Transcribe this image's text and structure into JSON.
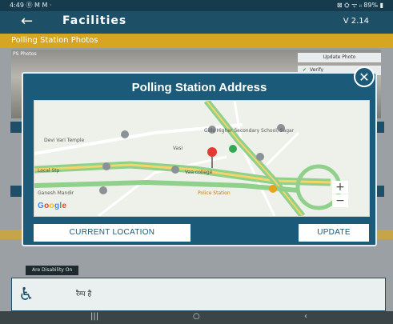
{
  "status_bar": {
    "left": "4:49 ⓪ M M ·",
    "right": "⊠ ⛭ ᯤ ᵢₗ 89% ▮"
  },
  "app_bar": {
    "back_glyph": "←",
    "title": "Facilities",
    "version": "V 2.14"
  },
  "section": {
    "title": "Polling Station Photos"
  },
  "background": {
    "photo_label": "PS Photos",
    "chip_label": "Update Photo",
    "verify_label": "Verify"
  },
  "dialog": {
    "title": "Polling Station Address",
    "close_glyph": "✕",
    "map": {
      "places": {
        "temple": "Devi Vari Temple",
        "school": "Girls Higher Secondary School, Sagar",
        "vasi": "Vasi",
        "college": "Vaa college",
        "local": "Local Stp",
        "mandir": "Ganesh Mandir",
        "station": "Police Station"
      },
      "google_letters": [
        {
          "ch": "G",
          "color": "#4285F4"
        },
        {
          "ch": "o",
          "color": "#EA4335"
        },
        {
          "ch": "o",
          "color": "#FBBC05"
        },
        {
          "ch": "g",
          "color": "#4285F4"
        },
        {
          "ch": "l",
          "color": "#34A853"
        },
        {
          "ch": "e",
          "color": "#EA4335"
        }
      ],
      "zoom_in": "+",
      "zoom_out": "−"
    },
    "current_location_label": "CURRENT LOCATION",
    "update_label": "UPDATE"
  },
  "tag": {
    "label": "Are Disability On"
  },
  "facility_card": {
    "icon": "♿",
    "text": "रैम्प है"
  },
  "nav": {
    "recents": "|||",
    "home": "○",
    "back": "‹"
  }
}
